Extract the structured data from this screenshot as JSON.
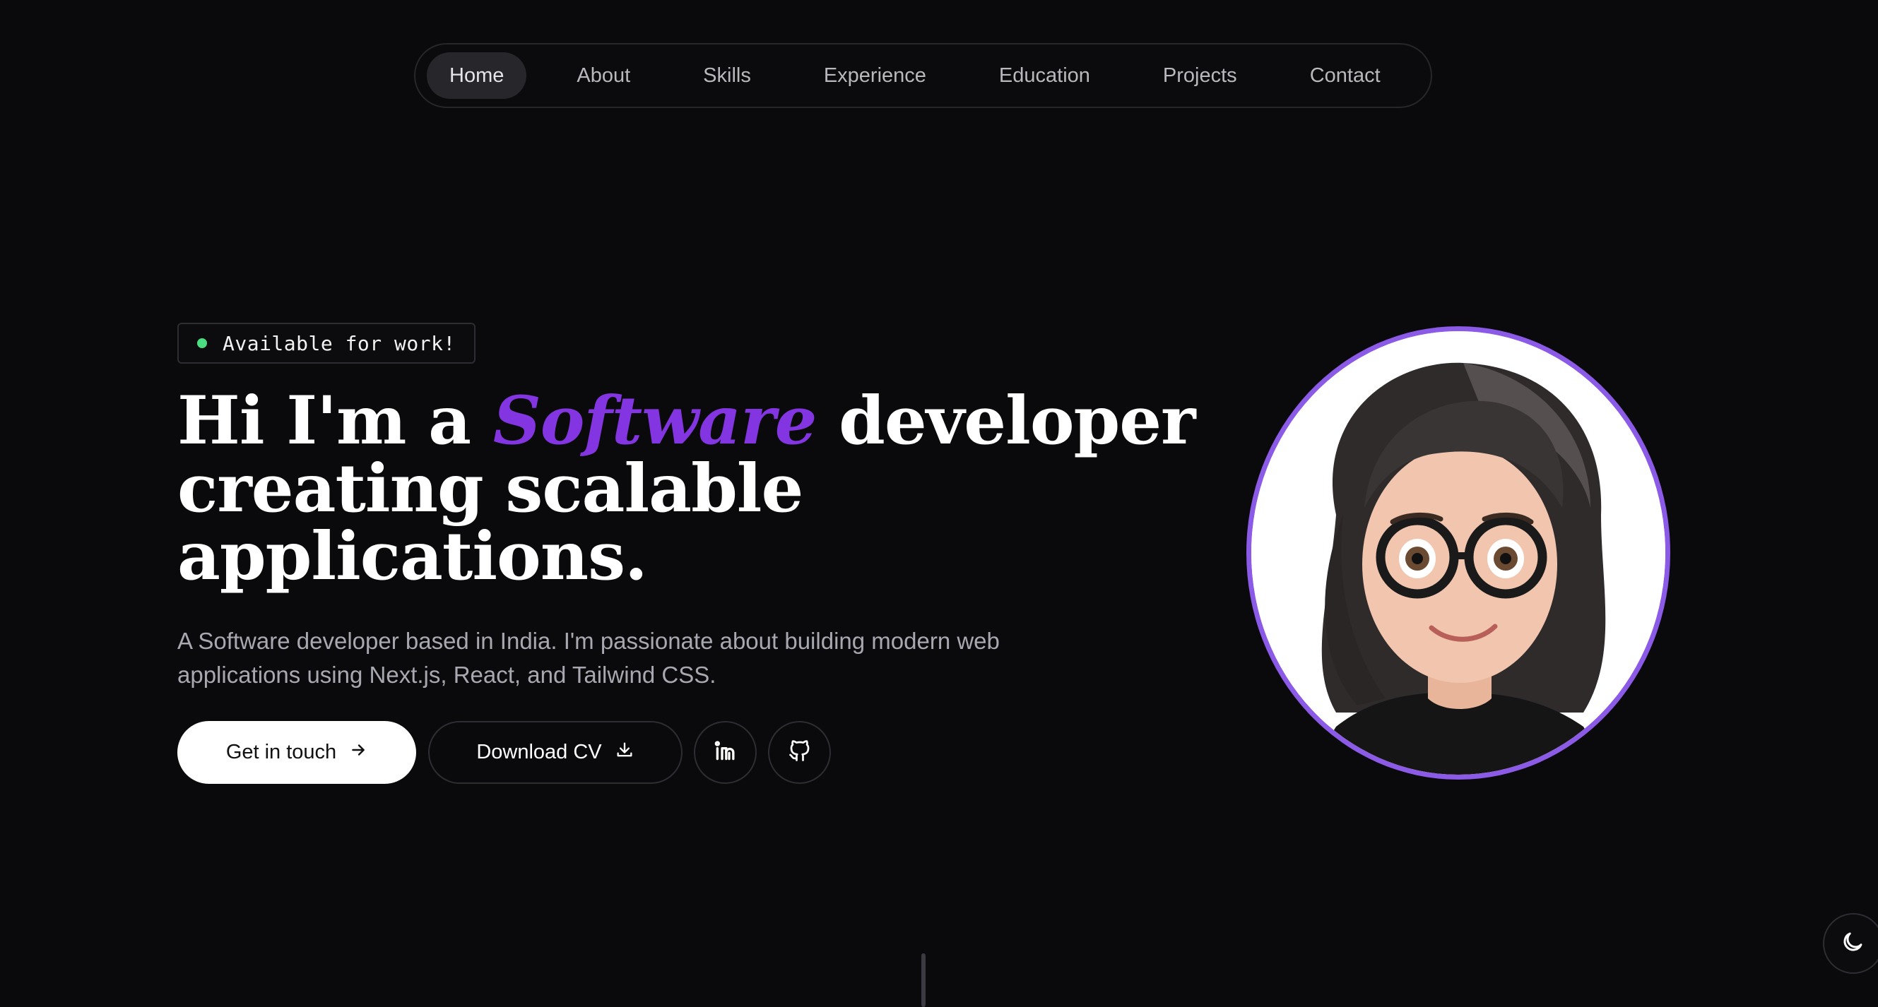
{
  "nav": {
    "items": [
      {
        "label": "Home",
        "active": true
      },
      {
        "label": "About"
      },
      {
        "label": "Skills"
      },
      {
        "label": "Experience"
      },
      {
        "label": "Education"
      },
      {
        "label": "Projects"
      },
      {
        "label": "Contact"
      }
    ]
  },
  "hero": {
    "badge": "Available for work!",
    "headline": {
      "part1": "Hi I'm a ",
      "accent": "Software",
      "part2": " developer creating scalable applications."
    },
    "subtitle": "A Software developer based in India. I'm passionate about building modern web applications using Next.js, React, and Tailwind CSS.",
    "buttons": {
      "primary": "Get in touch",
      "secondary": "Download CV"
    }
  },
  "colors": {
    "background": "#0a0a0c",
    "accent": "#8235e0",
    "avatar_ring": "#8b5ae6",
    "status": "#4ade80"
  },
  "icons": {
    "primary_button": "arrow-right-icon",
    "secondary_button": "download-icon",
    "social": [
      "linkedin-icon",
      "github-icon"
    ],
    "theme_toggle": "moon-icon"
  }
}
